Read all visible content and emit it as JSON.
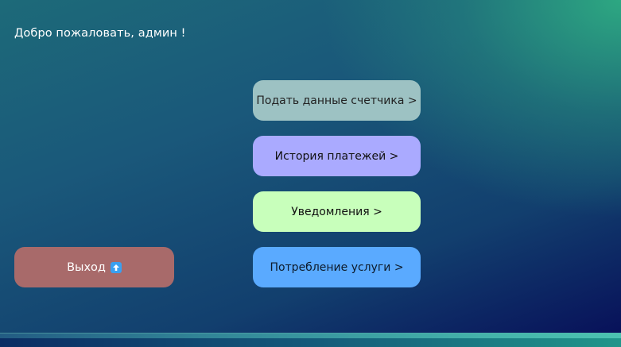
{
  "header": {
    "welcome_text": "Добро пожаловать, админ !"
  },
  "menu": {
    "meter_label": "Подать данные счетчика >",
    "history_label": "История платежей >",
    "notifications_label": "Уведомления >",
    "usage_label": "Потребление услуги >"
  },
  "exit": {
    "label": "Выход",
    "icon": "up-arrow-icon"
  },
  "colors": {
    "meter_button": "#9dc2c3",
    "history_button": "#aaaaff",
    "notifications_button": "#c8ffbb",
    "usage_button": "#5aaaff",
    "exit_button": "#a86a6a",
    "exit_icon": "#3aa0f0"
  }
}
